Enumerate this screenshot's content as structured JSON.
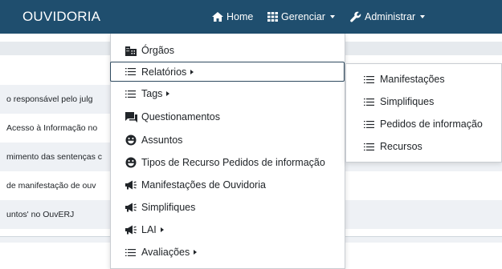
{
  "navbar": {
    "brand": "OUVIDORIA",
    "home_label": "Home",
    "gerenciar_label": "Gerenciar",
    "administrar_label": "Administrar",
    "bg_color": "#1f4e6e"
  },
  "background_rows": [
    "o responsável pelo julg",
    "Acesso à Informação no",
    "mimento das sentenças c",
    "de manifestação de ouv",
    "untos' no OuvERJ"
  ],
  "dropdown": {
    "items": [
      {
        "label": "Órgãos",
        "icon": "building-icon"
      },
      {
        "label": "Relatórios",
        "icon": "list-icon",
        "submenu": true
      },
      {
        "label": "Tags",
        "icon": "list-icon",
        "submenu": true
      },
      {
        "label": "Questionamentos",
        "icon": "comments-icon"
      },
      {
        "label": "Assuntos",
        "icon": "grin-icon"
      },
      {
        "label": "Tipos de Recurso Pedidos de informação",
        "icon": "grin-icon"
      },
      {
        "label": "Manifestações de Ouvidoria",
        "icon": "bullhorn-icon"
      },
      {
        "label": "Simplifiques",
        "icon": "bullhorn-icon"
      },
      {
        "label": "LAI",
        "icon": "bullhorn-icon",
        "submenu": true
      },
      {
        "label": "Avaliações",
        "icon": "list-icon",
        "submenu": true
      }
    ]
  },
  "submenu": {
    "items": [
      {
        "label": "Manifestações",
        "icon": "list-icon"
      },
      {
        "label": "Simplifiques",
        "icon": "list-icon"
      },
      {
        "label": "Pedidos de informação",
        "icon": "list-icon"
      },
      {
        "label": "Recursos",
        "icon": "list-icon"
      }
    ]
  }
}
